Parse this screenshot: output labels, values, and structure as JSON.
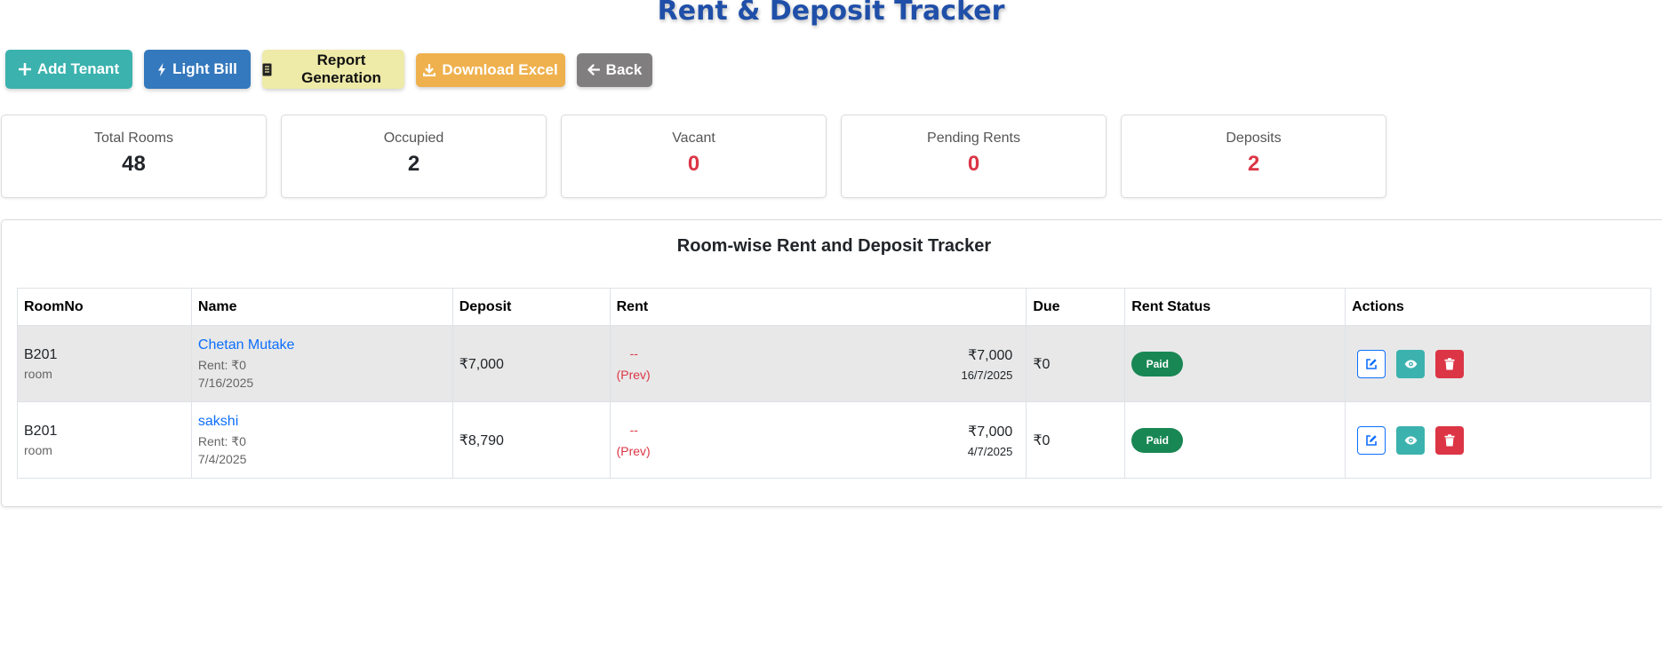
{
  "header": {
    "title": "Rent & Deposit Tracker"
  },
  "toolbar": {
    "add_tenant": "Add Tenant",
    "light_bill": "Light Bill",
    "report_generation": "Report Generation",
    "download_excel": "Download Excel",
    "back": "Back"
  },
  "stats": [
    {
      "label": "Total Rooms",
      "value": "48"
    },
    {
      "label": "Occupied",
      "value": "2"
    },
    {
      "label": "Vacant",
      "value": "0"
    },
    {
      "label": "Pending Rents",
      "value": "0"
    },
    {
      "label": "Deposits",
      "value": "2"
    }
  ],
  "tracker": {
    "title": "Room-wise Rent and Deposit Tracker",
    "columns": [
      "RoomNo",
      "Name",
      "Deposit",
      "Rent",
      "Due",
      "Rent Status",
      "Actions"
    ],
    "rows": [
      {
        "room_no": "B201",
        "room_type": "room",
        "name": "Chetan Mutake",
        "rent_line": "Rent: ₹0",
        "date_line": "7/16/2025",
        "deposit": "₹7,000",
        "prev_dash": "--",
        "prev_label": "(Prev)",
        "rent_amount": "₹7,000",
        "rent_date": "16/7/2025",
        "due": "₹0",
        "status": "Paid"
      },
      {
        "room_no": "B201",
        "room_type": "room",
        "name": "sakshi",
        "rent_line": "Rent: ₹0",
        "date_line": "7/4/2025",
        "deposit": "₹8,790",
        "prev_dash": "--",
        "prev_label": "(Prev)",
        "rent_amount": "₹7,000",
        "rent_date": "4/7/2025",
        "due": "₹0",
        "status": "Paid"
      }
    ]
  },
  "icons": {
    "add": "plus-icon",
    "light": "bolt-icon",
    "report": "receipt-icon",
    "download": "download-icon",
    "back": "arrow-left-icon",
    "edit": "edit-icon",
    "view": "eye-icon",
    "delete": "trash-icon"
  },
  "colors": {
    "title": "#1f4fa8",
    "add_tenant": "#3bb2ae",
    "light_bill": "#3478bd",
    "report_generation": "#eeeaa8",
    "download_excel": "#efb14e",
    "back": "#807e7e",
    "danger": "#dc3545",
    "success": "#198754",
    "link": "#0d6efd"
  }
}
